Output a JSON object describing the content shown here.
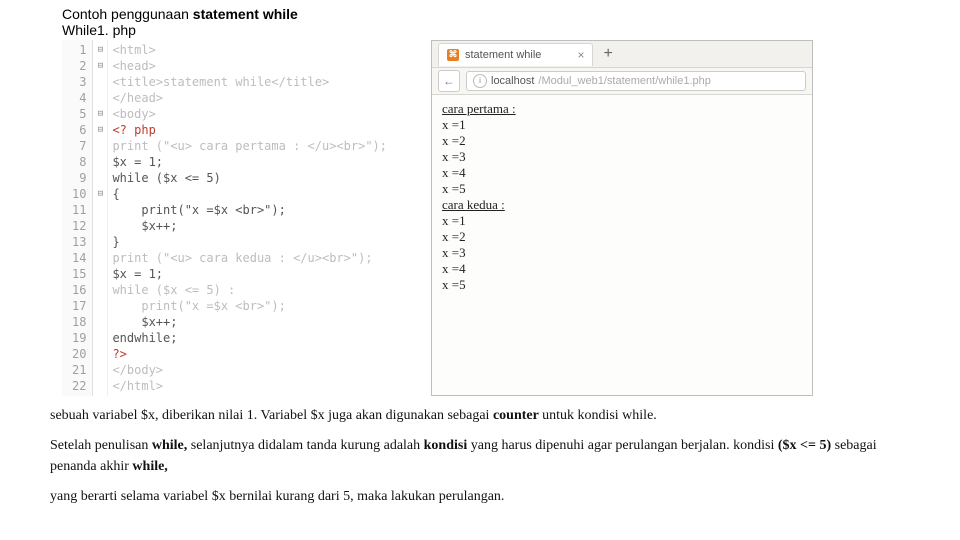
{
  "header": {
    "line1_a": "Contoh penggunaan ",
    "line1_b": "statement while",
    "line2": "While1. php"
  },
  "code": {
    "lines": [
      {
        "n": "1",
        "f": "⊟",
        "cls": "dim",
        "t": "<html>"
      },
      {
        "n": "2",
        "f": "⊟",
        "cls": "dim",
        "t": "<head>"
      },
      {
        "n": "3",
        "f": "",
        "cls": "dim",
        "t": "<title>statement while</title>"
      },
      {
        "n": "4",
        "f": "",
        "cls": "dim",
        "t": "</head>"
      },
      {
        "n": "5",
        "f": "⊟",
        "cls": "dim",
        "t": "<body>"
      },
      {
        "n": "6",
        "f": "⊟",
        "cls": "red",
        "t": "<? php"
      },
      {
        "n": "7",
        "f": "",
        "cls": "dim",
        "t": "print (\"<u> cara pertama : </u><br>\");"
      },
      {
        "n": "8",
        "f": "",
        "cls": "dark",
        "t": "$x = 1;"
      },
      {
        "n": "9",
        "f": "",
        "cls": "dark",
        "t": "while ($x <= 5)"
      },
      {
        "n": "10",
        "f": "⊟",
        "cls": "dark",
        "t": "{"
      },
      {
        "n": "11",
        "f": "",
        "cls": "dark",
        "t": "    print(\"x =$x <br>\");"
      },
      {
        "n": "12",
        "f": "",
        "cls": "dark",
        "t": "    $x++;"
      },
      {
        "n": "13",
        "f": "",
        "cls": "dark",
        "t": "}"
      },
      {
        "n": "14",
        "f": "",
        "cls": "dim",
        "t": "print (\"<u> cara kedua : </u><br>\");"
      },
      {
        "n": "15",
        "f": "",
        "cls": "dark",
        "t": "$x = 1;"
      },
      {
        "n": "16",
        "f": "",
        "cls": "dim",
        "t": "while ($x <= 5) :"
      },
      {
        "n": "17",
        "f": "",
        "cls": "dim",
        "t": "    print(\"x =$x <br>\");"
      },
      {
        "n": "18",
        "f": "",
        "cls": "dark",
        "t": "    $x++;"
      },
      {
        "n": "19",
        "f": "",
        "cls": "dark",
        "t": "endwhile;"
      },
      {
        "n": "20",
        "f": "",
        "cls": "red",
        "t": "?>"
      },
      {
        "n": "21",
        "f": "",
        "cls": "dim",
        "t": "</body>"
      },
      {
        "n": "22",
        "f": "",
        "cls": "dim",
        "t": "</html>"
      }
    ]
  },
  "browser": {
    "tab_title": "statement while",
    "tab_close": "×",
    "tab_plus": "+",
    "back": "←",
    "info": "i",
    "url_host": "localhost",
    "url_path": "/Modul_web1/statement/while1.php",
    "output": {
      "h1": "cara pertama :",
      "rows1": [
        "x =1",
        "x =2",
        "x =3",
        "x =4",
        "x =5"
      ],
      "h2": "cara kedua :",
      "rows2": [
        "x =1",
        "x =2",
        "x =3",
        "x =4",
        "x =5"
      ]
    }
  },
  "paras": {
    "p1_a": "sebuah variabel $x, diberikan nilai 1. Variabel $x juga akan digunakan sebagai ",
    "p1_b": "counter ",
    "p1_c": "untuk kondisi while.",
    "p2_a": "Setelah penulisan ",
    "p2_b": "while, ",
    "p2_c": "selanjutnya didalam tanda kurung adalah ",
    "p2_d": "kondisi ",
    "p2_e": "yang harus dipenuhi agar perulangan berjalan. kondisi ",
    "p2_f": "($x <= 5) ",
    "p2_g": "sebagai penanda akhir ",
    "p2_h": "while,",
    "p3": "yang berarti selama variabel $x bernilai kurang dari 5, maka lakukan perulangan."
  }
}
